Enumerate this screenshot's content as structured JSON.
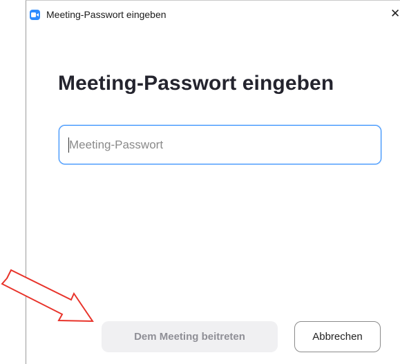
{
  "window": {
    "title": "Meeting-Passwort eingeben",
    "close_glyph": "✕",
    "accent_color": "#2d8cff",
    "app_icon": "video-camera-icon"
  },
  "dialog": {
    "heading": "Meeting-Passwort eingeben",
    "password_field": {
      "placeholder": "Meeting-Passwort",
      "value": ""
    },
    "join_button": {
      "label": "Dem Meeting beitreten",
      "enabled": false
    },
    "cancel_button": {
      "label": "Abbrechen"
    }
  },
  "annotation": {
    "arrow_color": "#e8332a",
    "arrow_target": "join_button"
  }
}
